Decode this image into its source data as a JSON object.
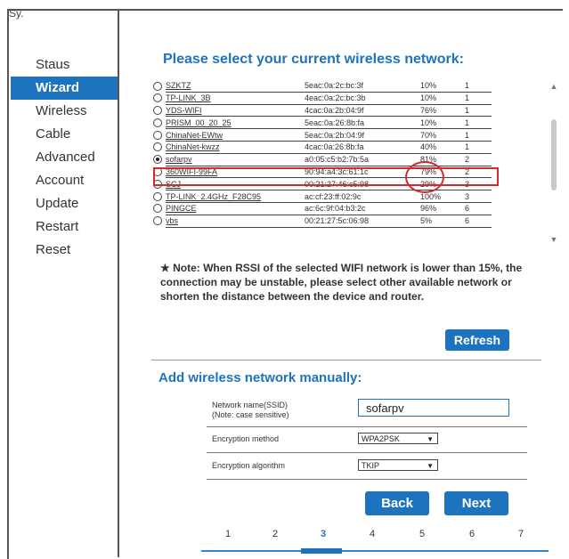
{
  "corner_text": "Sy.",
  "sidebar": {
    "items": [
      {
        "label": "Staus"
      },
      {
        "label": "Wizard"
      },
      {
        "label": "Wireless"
      },
      {
        "label": "Cable"
      },
      {
        "label": "Advanced"
      },
      {
        "label": "Account"
      },
      {
        "label": "Update"
      },
      {
        "label": "Restart"
      },
      {
        "label": "Reset"
      }
    ],
    "active_index": 1
  },
  "main": {
    "title": "Please select your current wireless network:",
    "networks": [
      {
        "ssid": "SZKTZ",
        "mac": "5eac:0a:2c:bc:3f",
        "signal": "10%",
        "channel": "1",
        "selected": false
      },
      {
        "ssid": "TP-LINK_3B",
        "mac": "4eac:0a:2c:bc:3b",
        "signal": "10%",
        "channel": "1",
        "selected": false
      },
      {
        "ssid": "YDS-WIFI",
        "mac": "4cac:0a:2b:04:9f",
        "signal": "76%",
        "channel": "1",
        "selected": false
      },
      {
        "ssid": "PRISM_00_20_25",
        "mac": "5eac:0a:26:8b:fa",
        "signal": "10%",
        "channel": "1",
        "selected": false
      },
      {
        "ssid": "ChinaNet-EWtw",
        "mac": "5eac:0a:2b:04:9f",
        "signal": "70%",
        "channel": "1",
        "selected": false
      },
      {
        "ssid": "ChinaNet-kwzz",
        "mac": "4cac:0a:26:8b:fa",
        "signal": "40%",
        "channel": "1",
        "selected": false
      },
      {
        "ssid": "sofarpv",
        "mac": "a0:05:c5:b2:7b:5a",
        "signal": "81%",
        "channel": "2",
        "selected": true
      },
      {
        "ssid": "360WIFI-99FA",
        "mac": "90:94:a4:3c:61:1c",
        "signal": "79%",
        "channel": "2",
        "selected": false
      },
      {
        "ssid": "SCJ",
        "mac": "00:21:27:46:c5:98",
        "signal": "29%",
        "channel": "3",
        "selected": false
      },
      {
        "ssid": "TP-LINK_2.4GHz_F28C95",
        "mac": "ac:cf:23:ff:02:9c",
        "signal": "100%",
        "channel": "3",
        "selected": false
      },
      {
        "ssid": "PINGCE",
        "mac": "ac:6c:9f:04:b3:2c",
        "signal": "96%",
        "channel": "6",
        "selected": false
      },
      {
        "ssid": "ybs",
        "mac": "00:21:27:5c:06:98",
        "signal": "5%",
        "channel": "6",
        "selected": false
      }
    ],
    "note": "★ Note: When RSSI of the selected WIFI network is lower than 15%, the connection may be unstable, please select other available network or shorten the distance between the device and router.",
    "refresh_label": "Refresh"
  },
  "manual": {
    "title": "Add wireless network manually:",
    "ssid_label_1": "Network name(SSID)",
    "ssid_label_2": "(Note: case sensitive)",
    "ssid_value": "sofarpv",
    "enc_method_label": "Encryption method",
    "enc_method_value": "WPA2PSK",
    "enc_alg_label": "Encryption algorithm",
    "enc_alg_value": "TKIP"
  },
  "nav": {
    "back_label": "Back",
    "next_label": "Next"
  },
  "steps": {
    "items": [
      "1",
      "2",
      "3",
      "4",
      "5",
      "6",
      "7"
    ],
    "active": "3"
  },
  "colors": {
    "accent": "#1e73be",
    "highlight": "#d6282f"
  }
}
